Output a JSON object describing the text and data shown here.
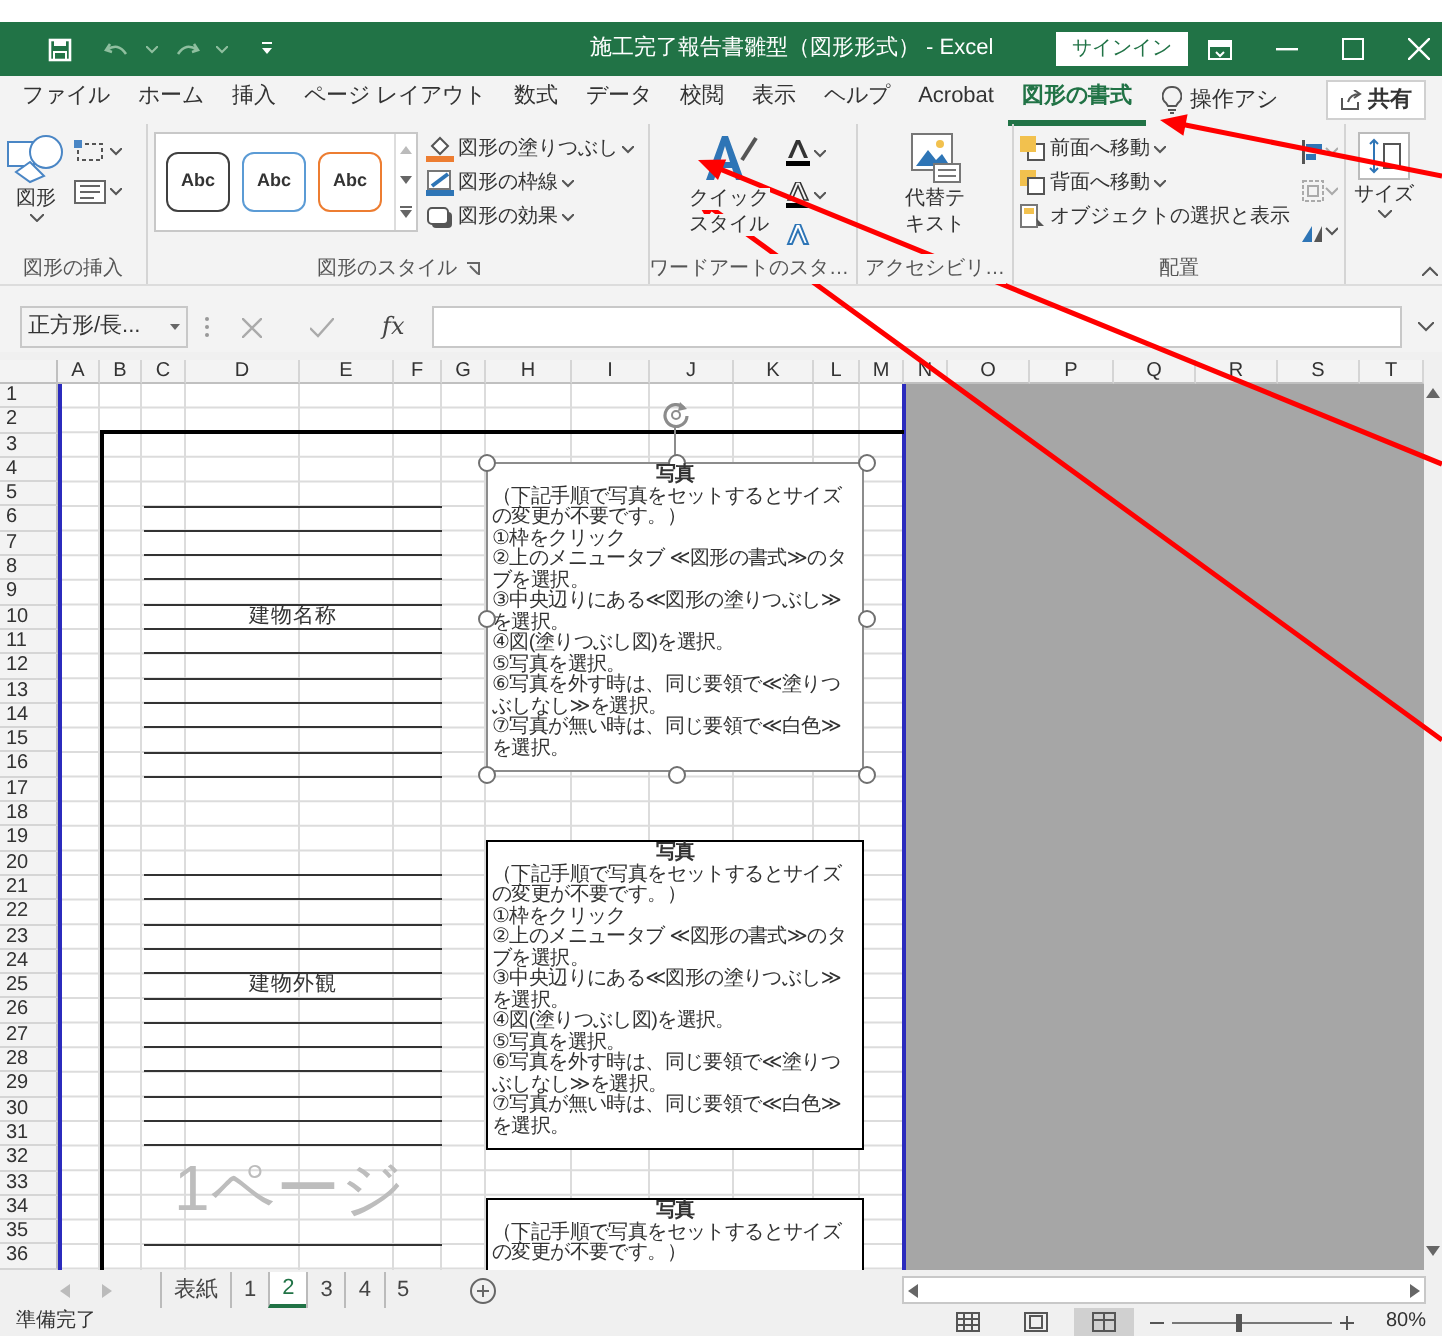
{
  "window": {
    "title": "施工完了報告書雛型（図形形式） - Excel",
    "sign_in": "サインイン"
  },
  "ribbon_tabs": [
    {
      "label": "ファイル",
      "selected": false
    },
    {
      "label": "ホーム",
      "selected": false
    },
    {
      "label": "挿入",
      "selected": false
    },
    {
      "label": "ページ レイアウト",
      "selected": false
    },
    {
      "label": "数式",
      "selected": false
    },
    {
      "label": "データ",
      "selected": false
    },
    {
      "label": "校閲",
      "selected": false
    },
    {
      "label": "表示",
      "selected": false
    },
    {
      "label": "ヘルプ",
      "selected": false
    },
    {
      "label": "Acrobat",
      "selected": false
    },
    {
      "label": "図形の書式",
      "selected": true
    }
  ],
  "tell_me": "操作アシ",
  "share": "共有",
  "ribbon_groups": [
    {
      "label": "図形の挿入",
      "button": "図形"
    },
    {
      "label": "図形のスタイル",
      "styles": [
        {
          "label": "Abc",
          "color": "#404040"
        },
        {
          "label": "Abc",
          "color": "#5b9bd5"
        },
        {
          "label": "Abc",
          "color": "#ed7d31"
        }
      ],
      "commands": [
        "図形の塗りつぶし",
        "図形の枠線",
        "図形の効果"
      ]
    },
    {
      "label": "ワードアートのスタ…",
      "button_lines": [
        "クイック",
        "スタイル"
      ]
    },
    {
      "label": "アクセシビリ…",
      "button_lines": [
        "代替テ",
        "キスト"
      ]
    },
    {
      "label": "配置",
      "commands": [
        "前面へ移動",
        "背面へ移動",
        "オブジェクトの選択と表示"
      ]
    },
    {
      "button": "サイズ"
    }
  ],
  "formula_bar": {
    "name_box": "正方形/長...",
    "function_label": "fx"
  },
  "columns": [
    "A",
    "B",
    "C",
    "D",
    "E",
    "F",
    "G",
    "H",
    "I",
    "J",
    "K",
    "L",
    "M",
    "N",
    "O",
    "P",
    "Q",
    "R",
    "S",
    "T"
  ],
  "row_numbers": [
    "1",
    "2",
    "3",
    "4",
    "5",
    "6",
    "7",
    "8",
    "9",
    "10",
    "11",
    "12",
    "13",
    "14",
    "15",
    "16",
    "17",
    "18",
    "19",
    "20",
    "21",
    "22",
    "23",
    "24",
    "25",
    "26",
    "27",
    "28",
    "29",
    "30",
    "31",
    "32",
    "33",
    "34",
    "35",
    "36"
  ],
  "sheet": {
    "labels": [
      "建物名称",
      "建物外観"
    ],
    "photo_boxes": [
      {
        "title": "写真",
        "selected": true,
        "lines": [
          "（下記手順で写真をセットするとサイズの変更が不要です。）",
          "①枠をクリック",
          "②上のメニュータブ ≪図形の書式≫のタブを選択。",
          "③中央辺りにある≪図形の塗りつぶし≫を選択。",
          "④図(塗りつぶし図)を選択。",
          "⑤写真を選択。",
          "⑥写真を外す時は、同じ要領で≪塗りつぶしなし≫を選択。",
          "⑦写真が無い時は、同じ要領で≪白色≫を選択。"
        ]
      },
      {
        "title": "写真",
        "selected": false,
        "lines": [
          "（下記手順で写真をセットするとサイズの変更が不要です。）",
          "①枠をクリック",
          "②上のメニュータブ ≪図形の書式≫のタブを選択。",
          "③中央辺りにある≪図形の塗りつぶし≫を選択。",
          "④図(塗りつぶし図)を選択。",
          "⑤写真を選択。",
          "⑥写真を外す時は、同じ要領で≪塗りつぶしなし≫を選択。",
          "⑦写真が無い時は、同じ要領で≪白色≫を選択。"
        ]
      },
      {
        "title": "写真",
        "selected": false,
        "lines": [
          "（下記手順で写真をセットするとサイズの変更が不要です。）"
        ]
      }
    ],
    "page_label": "1ページ"
  },
  "sheet_tabs": [
    {
      "label": "表紙",
      "selected": false
    },
    {
      "label": "1",
      "selected": false
    },
    {
      "label": "2",
      "selected": true
    },
    {
      "label": "3",
      "selected": false
    },
    {
      "label": "4",
      "selected": false
    },
    {
      "label": "5",
      "selected": false
    }
  ],
  "status_bar": {
    "text": "準備完了",
    "views": [
      {
        "selected": false
      },
      {
        "selected": false
      },
      {
        "selected": true
      }
    ],
    "zoom": {
      "level": 0.42,
      "reading": "80%"
    }
  }
}
